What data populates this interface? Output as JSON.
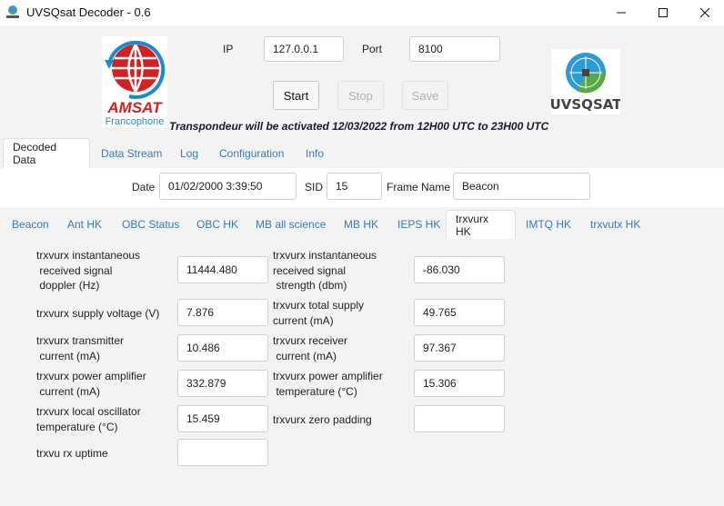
{
  "window": {
    "title": "UVSQsat Decoder - 0.6",
    "app_icon": "uvsqsat-app-icon",
    "controls": {
      "minimize": "minimize-icon",
      "maximize": "maximize-icon",
      "close": "close-icon"
    }
  },
  "header": {
    "logos": {
      "left": {
        "name": "AMSAT",
        "sub": "Francophone"
      },
      "right": {
        "name": "UVSQSAT"
      }
    },
    "ip_label": "IP",
    "ip_value": "127.0.0.1",
    "port_label": "Port",
    "port_value": "8100",
    "buttons": {
      "start": "Start",
      "stop": "Stop",
      "save": "Save"
    },
    "banner": "Transpondeur will be activated 12/03/2022 from 12H00 UTC to 23H00 UTC"
  },
  "main_tabs": [
    {
      "label": "Decoded Data",
      "active": true
    },
    {
      "label": "Data Stream",
      "active": false
    },
    {
      "label": "Log",
      "active": false
    },
    {
      "label": "Configuration",
      "active": false
    },
    {
      "label": "Info",
      "active": false
    }
  ],
  "frame": {
    "date_label": "Date",
    "date_value": "01/02/2000 3:39:50",
    "sid_label": "SID",
    "sid_value": "15",
    "frame_name_label": "Frame Name",
    "frame_name_value": "Beacon"
  },
  "sub_tabs": [
    {
      "label": "Beacon",
      "active": false
    },
    {
      "label": "Ant HK",
      "active": false
    },
    {
      "label": "OBC Status",
      "active": false
    },
    {
      "label": "OBC HK",
      "active": false
    },
    {
      "label": "MB all science",
      "active": false
    },
    {
      "label": "MB HK",
      "active": false
    },
    {
      "label": "IEPS HK",
      "active": false
    },
    {
      "label": "trxvurx HK",
      "active": true
    },
    {
      "label": "IMTQ HK",
      "active": false
    },
    {
      "label": "trxvutx HK",
      "active": false
    }
  ],
  "fields": {
    "left": [
      {
        "label": "trxvurx instantaneous\n received signal\n doppler (Hz)",
        "value": "11444.480"
      },
      {
        "label": "trxvurx supply voltage (V)",
        "value": "7.876"
      },
      {
        "label": "trxvurx transmitter\n current (mA)",
        "value": "10.486"
      },
      {
        "label": "trxvurx power amplifier\n current (mA)",
        "value": "332.879"
      },
      {
        "label": "trxvurx local oscillator\ntemperature (°C)",
        "value": "15.459"
      },
      {
        "label": "trxvu rx uptime",
        "value": ""
      }
    ],
    "right": [
      {
        "label": "trxvurx instantaneous\nreceived signal\n strength (dbm)",
        "value": "-86.030"
      },
      {
        "label": "trxvurx total supply\ncurrent (mA)",
        "value": "49.765"
      },
      {
        "label": "trxvurx receiver\n current (mA)",
        "value": "97.367"
      },
      {
        "label": "trxvurx power amplifier\n temperature (°C)",
        "value": "15.306"
      },
      {
        "label": "trxvurx zero padding",
        "value": ""
      }
    ]
  },
  "colors": {
    "tab_link": "#3a78b8",
    "amsat_red": "#d42020",
    "amsat_blue": "#1a8ad4"
  }
}
